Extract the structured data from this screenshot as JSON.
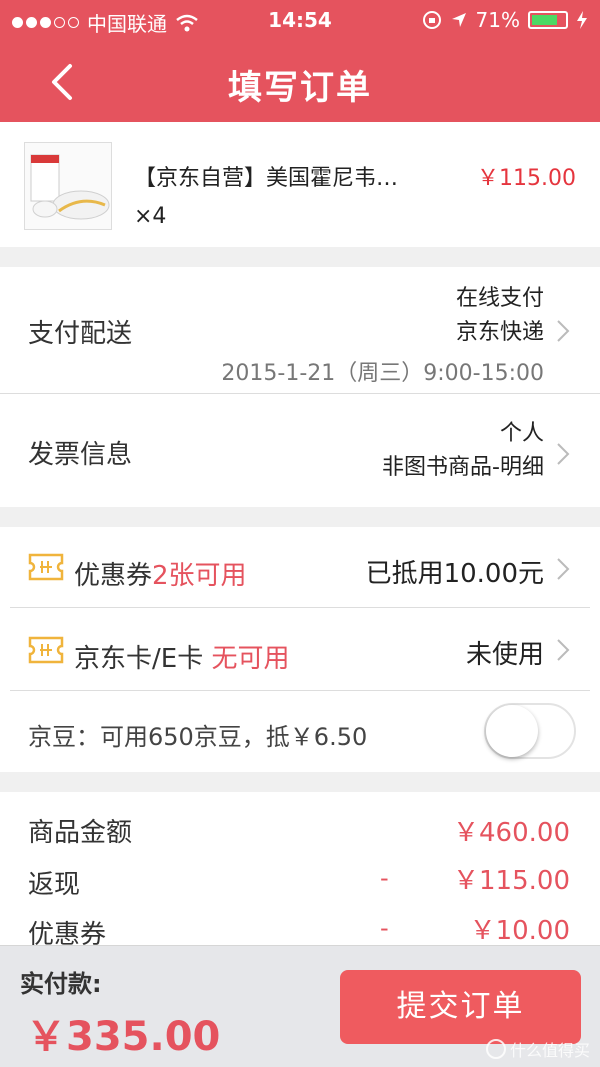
{
  "status_bar": {
    "carrier": "中国联通",
    "time": "14:54",
    "battery": "71%"
  },
  "nav": {
    "title": "填写订单"
  },
  "product": {
    "name": "【京东自营】美国霍尼韦…",
    "qty": "×4",
    "price": "￥115.00"
  },
  "payment": {
    "label": "支付配送",
    "method": "在线支付",
    "courier": "京东快递",
    "date": "2015-1-21（周三）9:00-15:00"
  },
  "invoice": {
    "label": "发票信息",
    "type": "个人",
    "content": "非图书商品-明细"
  },
  "coupon": {
    "label": "优惠券",
    "highlight": "2张可用",
    "status": "已抵用10.00元"
  },
  "jdcard": {
    "label": "京东卡/E卡",
    "highlight": "无可用",
    "status": "未使用"
  },
  "jingdou": {
    "label": "京豆：可用650京豆，抵￥6.50",
    "enabled": false
  },
  "summary": {
    "goods_label": "商品金额",
    "goods_value": "￥460.00",
    "rebate_label": "返现",
    "rebate_minus": "-",
    "rebate_value": "￥115.00",
    "coupon_label": "优惠券",
    "coupon_minus": "-",
    "coupon_value": "￥10.00"
  },
  "footer": {
    "pay_label": "实付款:",
    "total": "￥335.00",
    "submit_label": "提交订单",
    "watermark": "什么值得买"
  },
  "colors": {
    "brand": "#e5535e",
    "price_red": "#e5353e",
    "ticket_orange": "#f0b43c"
  }
}
